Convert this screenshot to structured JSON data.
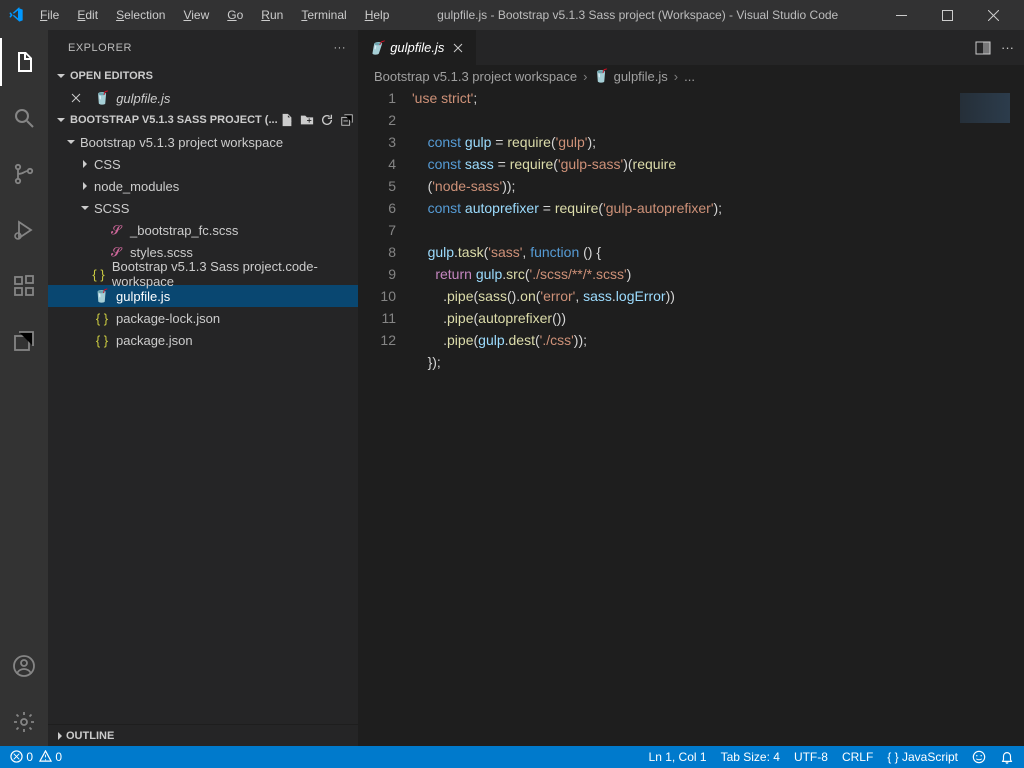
{
  "titlebar": {
    "menus": [
      "File",
      "Edit",
      "Selection",
      "View",
      "Go",
      "Run",
      "Terminal",
      "Help"
    ],
    "title": "gulpfile.js - Bootstrap v5.1.3 Sass project (Workspace) - Visual Studio Code"
  },
  "sidebar": {
    "title": "EXPLORER",
    "sections": {
      "openEditors": {
        "label": "OPEN EDITORS",
        "items": [
          {
            "name": "gulpfile.js",
            "icon": "gulp"
          }
        ]
      },
      "folder": {
        "label": "BOOTSTRAP V5.1.3 SASS PROJECT (...",
        "root": {
          "name": "Bootstrap v5.1.3 project workspace"
        },
        "tree": [
          {
            "depth": 1,
            "type": "folder",
            "expanded": false,
            "name": "CSS"
          },
          {
            "depth": 1,
            "type": "folder",
            "expanded": false,
            "name": "node_modules"
          },
          {
            "depth": 1,
            "type": "folder",
            "expanded": true,
            "name": "SCSS"
          },
          {
            "depth": 2,
            "type": "file",
            "icon": "sass",
            "name": "_bootstrap_fc.scss"
          },
          {
            "depth": 2,
            "type": "file",
            "icon": "sass",
            "name": "styles.scss"
          },
          {
            "depth": 1,
            "type": "file",
            "icon": "json",
            "name": "Bootstrap v5.1.3 Sass project.code-workspace"
          },
          {
            "depth": 1,
            "type": "file",
            "icon": "gulp",
            "name": "gulpfile.js",
            "selected": true
          },
          {
            "depth": 1,
            "type": "file",
            "icon": "json",
            "name": "package-lock.json"
          },
          {
            "depth": 1,
            "type": "file",
            "icon": "json",
            "name": "package.json"
          }
        ]
      },
      "outline": {
        "label": "OUTLINE"
      }
    }
  },
  "editor": {
    "tab": {
      "name": "gulpfile.js",
      "icon": "gulp"
    },
    "breadcrumb": [
      "Bootstrap v5.1.3 project workspace",
      "gulpfile.js",
      "..."
    ],
    "lines": [
      1,
      2,
      3,
      4,
      5,
      6,
      7,
      8,
      9,
      10,
      11,
      12
    ],
    "code": {
      "l1": "'use strict'",
      "l3": {
        "kw": "const",
        "v": "gulp",
        "fn": "require",
        "s": "'gulp'"
      },
      "l4": {
        "kw": "const",
        "v": "sass",
        "fn": "require",
        "s1": "'gulp-sass'",
        "fn2": "require"
      },
      "l4b": {
        "s": "'node-sass'"
      },
      "l5": {
        "kw": "const",
        "v": "autoprefixer",
        "fn": "require",
        "s": "'gulp-autoprefixer'"
      },
      "l7": {
        "obj": "gulp",
        "fn": "task",
        "s": "'sass'",
        "kw": "function"
      },
      "l8": {
        "kw": "return",
        "obj": "gulp",
        "fn": "src",
        "s": "'./scss/**/*.scss'"
      },
      "l9": {
        "p": "pipe",
        "fn": "sass",
        "m": "on",
        "s": "'error'",
        "obj": "sass",
        "prop": "logError"
      },
      "l10": {
        "p": "pipe",
        "fn": "autoprefixer"
      },
      "l11": {
        "p": "pipe",
        "obj": "gulp",
        "fn": "dest",
        "s": "'./css'"
      }
    }
  },
  "status": {
    "errors": "0",
    "warnings": "0",
    "ln": "Ln 1, Col 1",
    "tab": "Tab Size: 4",
    "enc": "UTF-8",
    "eol": "CRLF",
    "lang": "JavaScript"
  }
}
